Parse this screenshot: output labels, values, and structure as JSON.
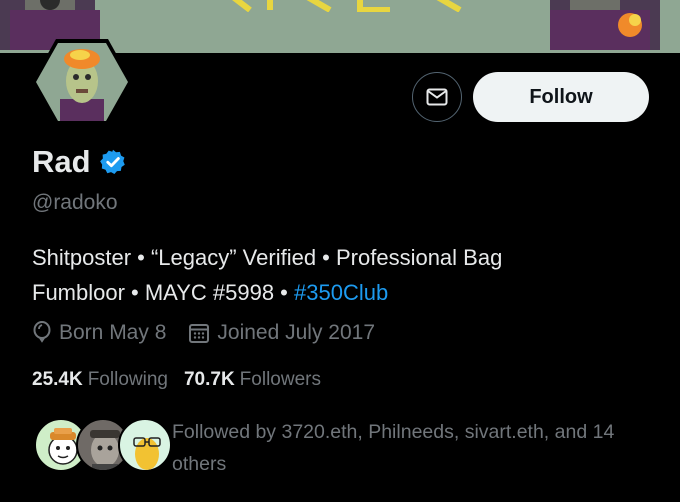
{
  "profile": {
    "display_name": "Rad",
    "handle": "@radoko",
    "bio": {
      "line1": "Shitposter • “Legacy” Verified • Professional Bag",
      "line2_text": "Fumbloor • MAYC #5998 • ",
      "line2_tag": "#350Club"
    },
    "born": "Born May 8",
    "joined": "Joined July 2017"
  },
  "stats": {
    "following_count": "25.4K",
    "following_label": "Following",
    "followers_count": "70.7K",
    "followers_label": "Followers"
  },
  "actions": {
    "follow_label": "Follow"
  },
  "followed_by": "Followed by 3720.eth, Philneeds, sivart.eth, and 14 others",
  "colors": {
    "background": "#000000",
    "primary_text": "#e7e9ea",
    "secondary_text": "#71767b",
    "accent_blue": "#1d9bf0",
    "follow_button_bg": "#eff3f4"
  },
  "icons": {
    "message": "envelope-icon",
    "verified": "verified-badge-icon",
    "birthday": "balloon-icon",
    "joined": "calendar-icon"
  }
}
